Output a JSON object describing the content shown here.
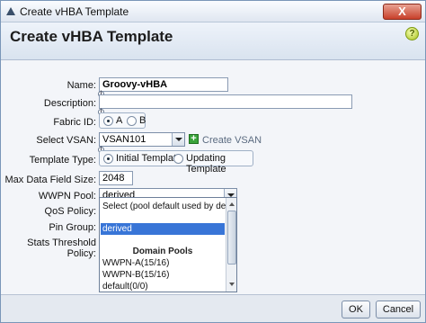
{
  "window": {
    "title": "Create vHBA Template",
    "close_label": "X"
  },
  "header": {
    "title": "Create vHBA Template",
    "help_label": "?"
  },
  "form": {
    "name": {
      "label": "Name:",
      "value": "Groovy-vHBA"
    },
    "description": {
      "label": "Description:",
      "value": ""
    },
    "fabric": {
      "label": "Fabric ID:",
      "options": [
        "A",
        "B"
      ],
      "selected": "A"
    },
    "vsan": {
      "label": "Select VSAN:",
      "value": "VSAN101",
      "create_label": "Create VSAN"
    },
    "template_type": {
      "label": "Template Type:",
      "options": [
        "Initial Template",
        "Updating Template"
      ],
      "selected": "Initial Template"
    },
    "max_data_field": {
      "label": "Max Data Field Size:",
      "value": "2048"
    },
    "wwpn_pool": {
      "label": "WWPN Pool:",
      "value": "derived"
    },
    "qos_policy": {
      "label": "QoS Policy:"
    },
    "pin_group": {
      "label": "Pin Group:"
    },
    "stats_policy": {
      "label": "Stats Threshold Policy:"
    }
  },
  "dropdown": {
    "items": [
      {
        "label": "Select (pool default used by default)",
        "selected": false
      },
      {
        "label": "derived",
        "selected": true
      }
    ],
    "group_title": "Domain Pools",
    "pools": [
      "WWPN-A(15/16)",
      "WWPN-B(15/16)",
      "default(0/0)"
    ]
  },
  "footer": {
    "ok_label": "OK",
    "cancel_label": "Cancel"
  },
  "colors": {
    "selection": "#3875d7",
    "close_button": "#c8402a",
    "add_icon": "#3aa33a"
  }
}
